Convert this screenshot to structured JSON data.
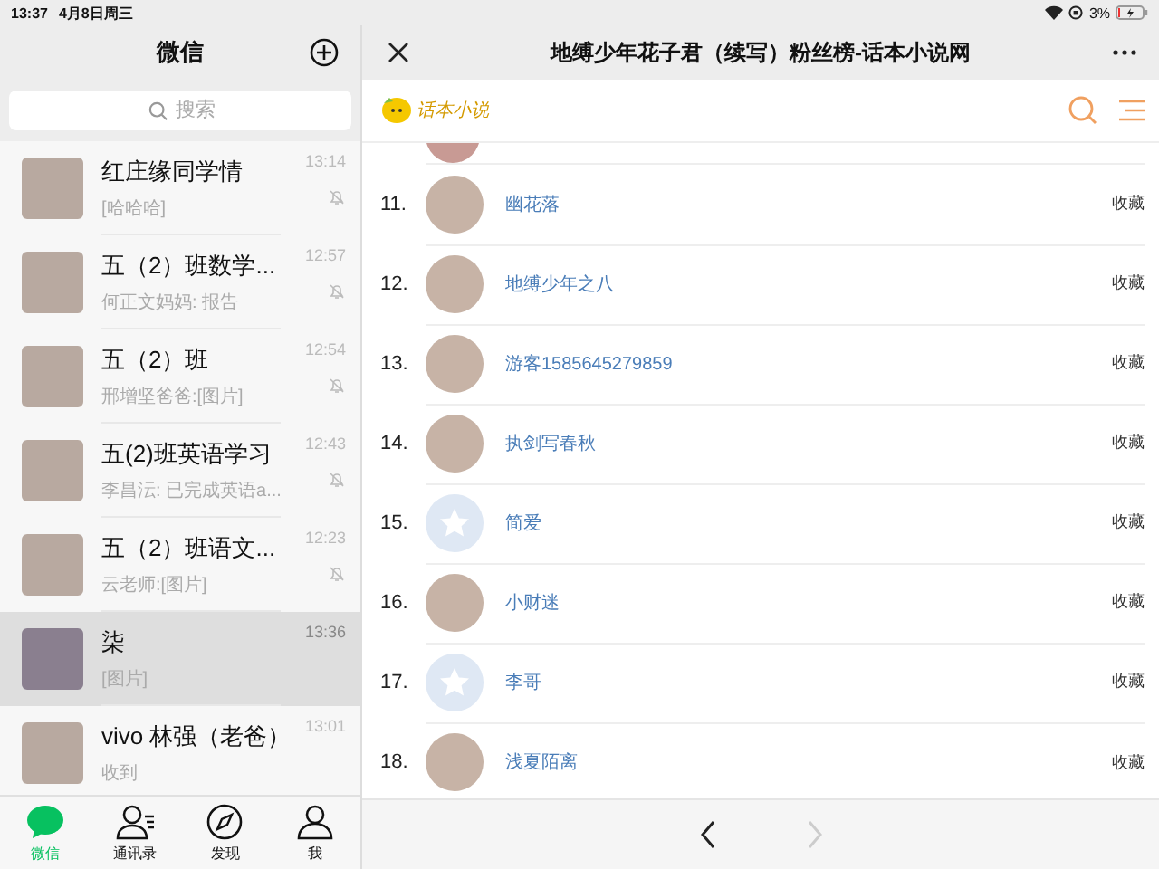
{
  "status_bar": {
    "time": "13:37",
    "date": "4月8日周三",
    "battery": "3%"
  },
  "chat_panel": {
    "title": "微信",
    "search": {
      "placeholder": "搜索"
    },
    "chats": [
      {
        "name": "红庄缘同学情",
        "preview": "[哈哈哈]",
        "time": "13:14",
        "muted": true,
        "selected": false
      },
      {
        "name": "五（2）班数学...",
        "preview": "何正文妈妈: 报告",
        "time": "12:57",
        "muted": true,
        "selected": false
      },
      {
        "name": "五（2）班",
        "preview": "邢增坚爸爸:[图片]",
        "time": "12:54",
        "muted": true,
        "selected": false
      },
      {
        "name": "五(2)班英语学习",
        "preview": "李昌沄: 已完成英语a...",
        "time": "12:43",
        "muted": true,
        "selected": false
      },
      {
        "name": "五（2）班语文...",
        "preview": "云老师:[图片]",
        "time": "12:23",
        "muted": true,
        "selected": false
      },
      {
        "name": "柒",
        "preview": "[图片]",
        "time": "13:36",
        "muted": false,
        "selected": true
      },
      {
        "name": "vivo 林强（老爸）",
        "preview": "收到",
        "time": "13:01",
        "muted": false,
        "selected": false
      }
    ],
    "tabs": [
      {
        "label": "微信",
        "kind": "chats",
        "selected": true
      },
      {
        "label": "通讯录",
        "kind": "contacts",
        "selected": false
      },
      {
        "label": "发现",
        "kind": "discover",
        "selected": false
      },
      {
        "label": "我",
        "kind": "me",
        "selected": false
      }
    ]
  },
  "web_panel": {
    "title": "地缚少年花子君（续写）粉丝榜-话本小说网",
    "site_logo": "话本小说",
    "fans": [
      {
        "rank": "11.",
        "name": "幽花落",
        "action": "收藏",
        "kind": "photo"
      },
      {
        "rank": "12.",
        "name": "地缚少年之八",
        "action": "收藏",
        "kind": "photo"
      },
      {
        "rank": "13.",
        "name": "游客1585645279859",
        "action": "收藏",
        "kind": "photo"
      },
      {
        "rank": "14.",
        "name": "执剑写春秋",
        "action": "收藏",
        "kind": "photo"
      },
      {
        "rank": "15.",
        "name": "简爱",
        "action": "收藏",
        "kind": "default"
      },
      {
        "rank": "16.",
        "name": "小财迷",
        "action": "收藏",
        "kind": "photo"
      },
      {
        "rank": "17.",
        "name": "李哥",
        "action": "收藏",
        "kind": "default"
      },
      {
        "rank": "18.",
        "name": "浅夏陌离",
        "action": "收藏",
        "kind": "photo"
      }
    ],
    "nav": {
      "back_disabled": false,
      "forward_disabled": true
    }
  }
}
